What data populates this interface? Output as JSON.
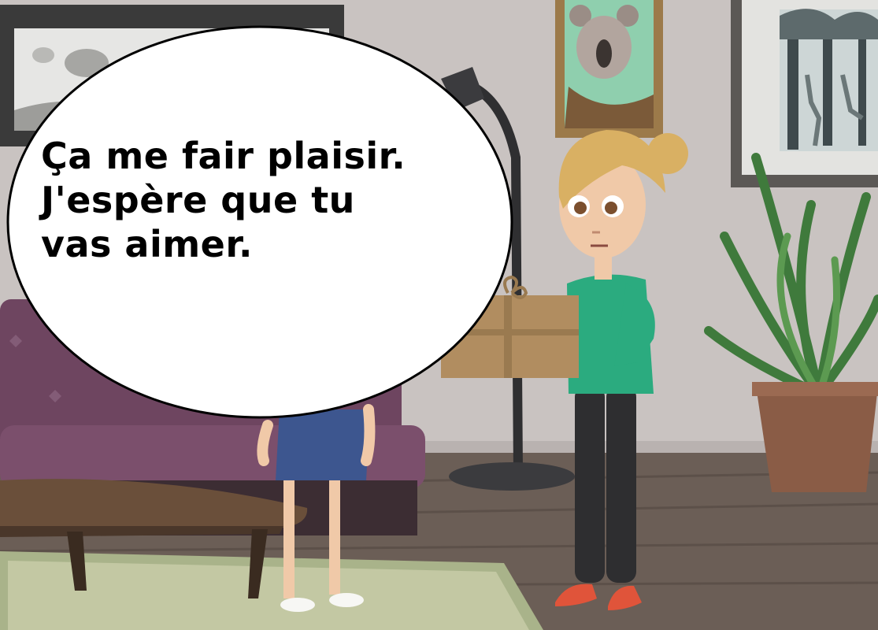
{
  "speech_bubble": {
    "lines": [
      "Ça me fair plaisir.",
      "J'espère que tu",
      "vas aimer."
    ]
  },
  "colors": {
    "wall": "#c9c3c1",
    "floor": "#6b5e56",
    "rug": "#a9b38a",
    "sofa": "#6e4560",
    "shirt": "#2bab7f",
    "hair": "#d9b063",
    "box": "#b18d60",
    "shoes": "#e0543a",
    "plant": "#3f7a3c",
    "pot": "#8a5c46"
  },
  "scene_objects": [
    "koala-picture",
    "deer-forest-picture",
    "landscape-picture",
    "floor-lamp",
    "sofa",
    "coffee-table",
    "potted-plant",
    "woman-holding-gift",
    "girl-in-blue-dress",
    "gift-box"
  ]
}
